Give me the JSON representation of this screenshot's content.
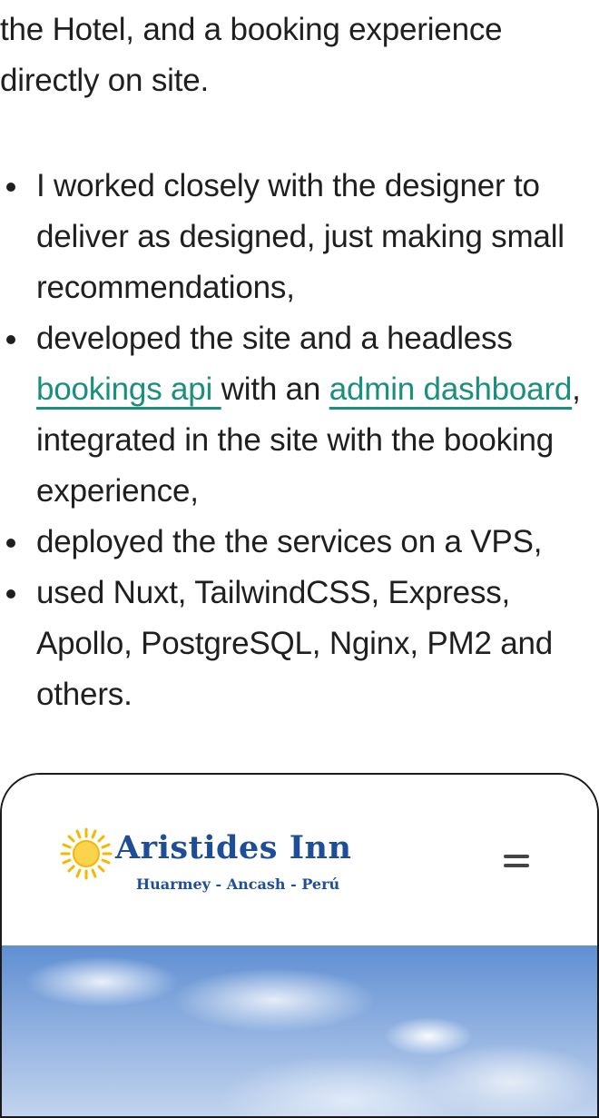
{
  "intro": {
    "line": "the Hotel, and a booking experience directly on site."
  },
  "bullets": [
    {
      "text": "I worked closely with the designer to deliver as designed, just making small recommendations,"
    },
    {
      "pre": "developed the site and a headless ",
      "link1": "bookings api ",
      "mid": "with an ",
      "link2": "admin dashboard",
      "post": ", integrated in the site with the booking experience,"
    },
    {
      "text": "deployed the the services on a VPS,"
    },
    {
      "text": "used Nuxt, TailwindCSS, Express, Apollo, PostgreSQL, Nginx, PM2 and others."
    }
  ],
  "preview": {
    "brand_name": "Aristides Inn",
    "brand_sub": "Huarmey - Ancash - Perú",
    "menu_icon": "hamburger-menu-icon",
    "sun_icon": "sun-icon"
  },
  "colors": {
    "link": "#1a8f7d",
    "brand": "#1f4e99",
    "sun": "#f5c518"
  }
}
